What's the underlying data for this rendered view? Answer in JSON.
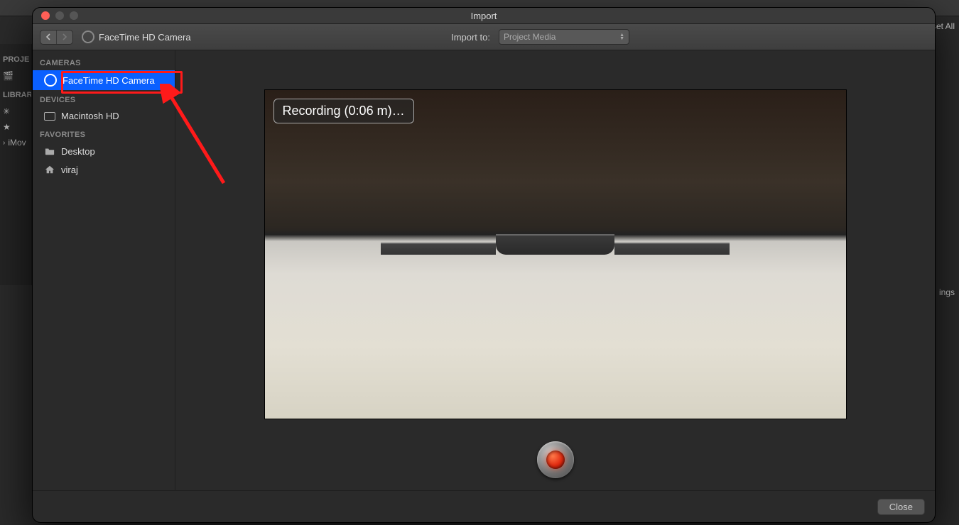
{
  "background": {
    "sidebar": {
      "section_projects_label": "PROJE",
      "section_library_label": "LIBRAR",
      "item_imovie_label": "iMov"
    },
    "right": {
      "reset_label": "set All",
      "settings_label": "ings"
    }
  },
  "import": {
    "title": "Import",
    "toolbar": {
      "camera_path": "FaceTime HD Camera",
      "import_to_label": "Import to:",
      "import_to_value": "Project Media"
    },
    "sidebar": {
      "section_cameras": "CAMERAS",
      "item_facetime": "FaceTime HD Camera",
      "section_devices": "DEVICES",
      "item_macintosh": "Macintosh HD",
      "section_favorites": "FAVORITES",
      "item_desktop": "Desktop",
      "item_home": "viraj"
    },
    "preview": {
      "recording_label": "Recording (0:06 m)…"
    },
    "footer": {
      "close_label": "Close"
    }
  }
}
